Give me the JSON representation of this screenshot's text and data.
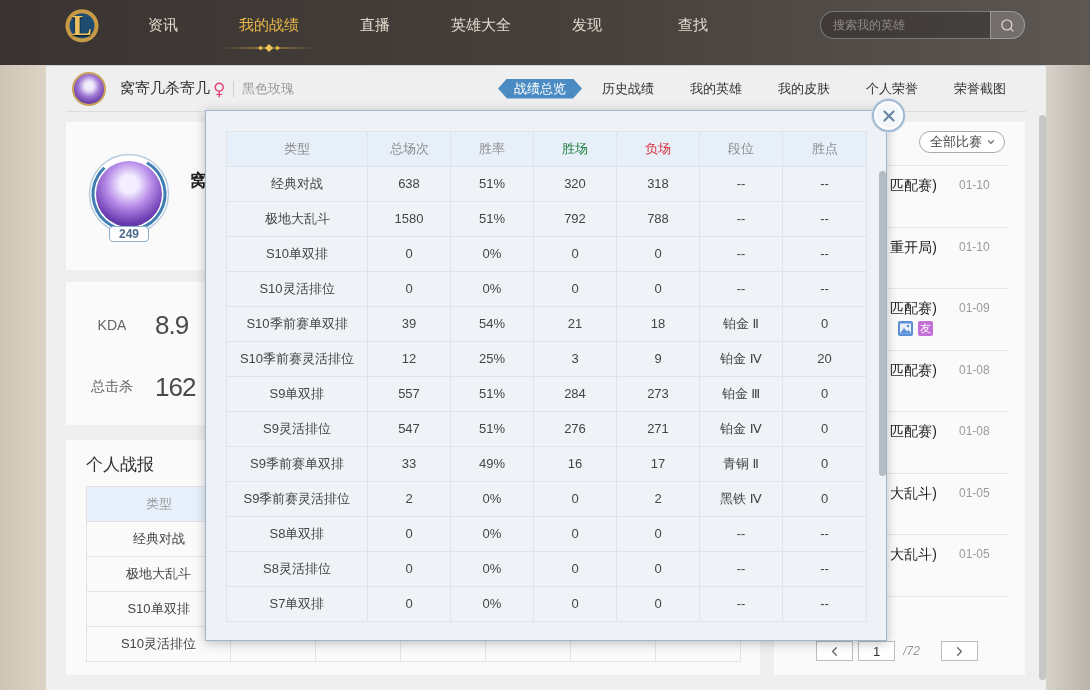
{
  "nav": {
    "logo": "L",
    "items": [
      {
        "label": "资讯",
        "selected": false
      },
      {
        "label": "我的战绩",
        "selected": true
      },
      {
        "label": "直播",
        "selected": false
      },
      {
        "label": "英雄大全",
        "selected": false
      },
      {
        "label": "发现",
        "selected": false
      },
      {
        "label": "查找",
        "selected": false
      }
    ],
    "search": {
      "placeholder": "搜索我的英雄"
    }
  },
  "profile_header": {
    "name": "窝寄几杀寄几",
    "gender_symbol": "♀",
    "title": "黑色玫瑰",
    "tabs": [
      {
        "label": "战绩总览",
        "selected": true
      },
      {
        "label": "历史战绩",
        "selected": false
      },
      {
        "label": "我的英雄",
        "selected": false
      },
      {
        "label": "我的皮肤",
        "selected": false
      },
      {
        "label": "个人荣誉",
        "selected": false
      },
      {
        "label": "荣誉截图",
        "selected": false
      }
    ]
  },
  "profile_card": {
    "name": "窝",
    "level": "249"
  },
  "stats": [
    {
      "label": "KDA",
      "value": "8.9"
    },
    {
      "label": "总击杀",
      "value": "162"
    }
  ],
  "personal_report": {
    "title": "个人战报",
    "header": "类型",
    "rows": [
      "经典对战",
      "极地大乱斗",
      "S10单双排",
      "S10灵活排位"
    ]
  },
  "match_list": {
    "filter": "全部比赛",
    "items": [
      {
        "mode": "匹配赛)",
        "date": "01-10"
      },
      {
        "mode": "重开局)",
        "date": "01-10"
      },
      {
        "mode": "匹配赛)",
        "date": "01-09",
        "tags": [
          {
            "kind": "image"
          },
          {
            "kind": "friend",
            "label": "友"
          }
        ]
      },
      {
        "mode": "匹配赛)",
        "date": "01-08"
      },
      {
        "mode": "匹配赛)",
        "date": "01-08"
      },
      {
        "mode": "大乱斗)",
        "date": "01-05"
      },
      {
        "mode": "大乱斗)",
        "date": "01-05"
      }
    ],
    "pagination": {
      "page": "1",
      "total": "/72"
    }
  },
  "stats_modal": {
    "columns": [
      {
        "label": "类型",
        "color": "#8c8c8c"
      },
      {
        "label": "总场次",
        "color": "#8c8c8c"
      },
      {
        "label": "胜率",
        "color": "#8c8c8c"
      },
      {
        "label": "胜场",
        "color": "#23803f"
      },
      {
        "label": "负场",
        "color": "#d8303a"
      },
      {
        "label": "段位",
        "color": "#8c8c8c"
      },
      {
        "label": "胜点",
        "color": "#8c8c8c"
      }
    ],
    "rows": [
      [
        "经典对战",
        "638",
        "51%",
        "320",
        "318",
        "--",
        "--"
      ],
      [
        "极地大乱斗",
        "1580",
        "51%",
        "792",
        "788",
        "--",
        "--"
      ],
      [
        "S10单双排",
        "0",
        "0%",
        "0",
        "0",
        "--",
        "--"
      ],
      [
        "S10灵活排位",
        "0",
        "0%",
        "0",
        "0",
        "--",
        "--"
      ],
      [
        "S10季前赛单双排",
        "39",
        "54%",
        "21",
        "18",
        "铂金 Ⅱ",
        "0"
      ],
      [
        "S10季前赛灵活排位",
        "12",
        "25%",
        "3",
        "9",
        "铂金 Ⅳ",
        "20"
      ],
      [
        "S9单双排",
        "557",
        "51%",
        "284",
        "273",
        "铂金 Ⅲ",
        "0"
      ],
      [
        "S9灵活排位",
        "547",
        "51%",
        "276",
        "271",
        "铂金 Ⅳ",
        "0"
      ],
      [
        "S9季前赛单双排",
        "33",
        "49%",
        "16",
        "17",
        "青铜 Ⅱ",
        "0"
      ],
      [
        "S9季前赛灵活排位",
        "2",
        "0%",
        "0",
        "2",
        "黑铁 Ⅳ",
        "0"
      ],
      [
        "S8单双排",
        "0",
        "0%",
        "0",
        "0",
        "--",
        "--"
      ],
      [
        "S8灵活排位",
        "0",
        "0%",
        "0",
        "0",
        "--",
        "--"
      ],
      [
        "S7单双排",
        "0",
        "0%",
        "0",
        "0",
        "--",
        "--"
      ]
    ]
  }
}
